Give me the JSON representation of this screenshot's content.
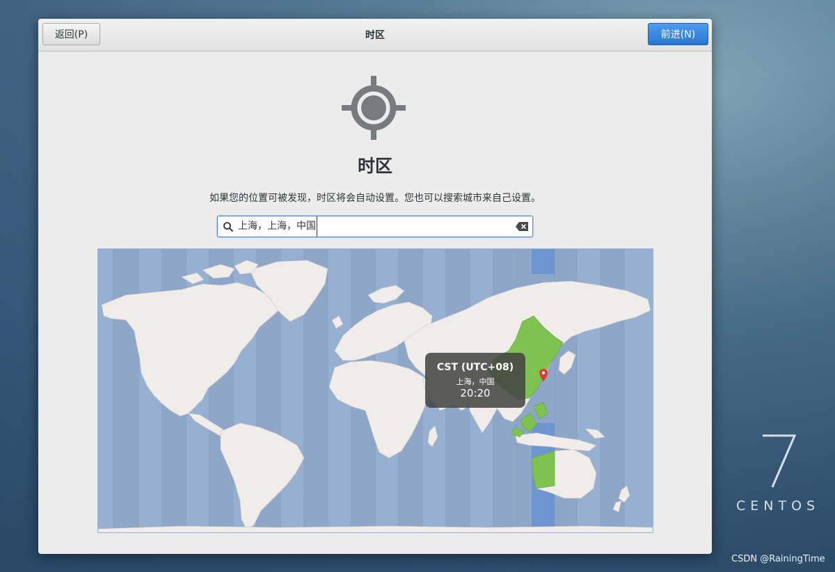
{
  "header": {
    "back_label": "返回(P)",
    "title": "时区",
    "next_label": "前进(N)"
  },
  "page": {
    "heading": "时区",
    "description": "如果您的位置可被发现，时区将会自动设置。您也可以搜索城市来自己设置。"
  },
  "search": {
    "value": "上海，上海，中国",
    "placeholder": ""
  },
  "map": {
    "tooltip": {
      "zone": "CST (UTC+08)",
      "city": "上海，中国",
      "time": "20:20"
    }
  },
  "brand": {
    "logo_mark": "7",
    "name": "CENTOS"
  },
  "watermark": "CSDN @RainingTime",
  "colors": {
    "ocean": "#8ea6c8",
    "land": "#efecea",
    "selected_zone": "#6d95cf",
    "selected_land": "#7ec24f",
    "pin": "#e0392c",
    "accent": "#2a76cf"
  },
  "icons": [
    "location-target-icon",
    "search-icon",
    "clear-icon",
    "map-pin-icon"
  ]
}
